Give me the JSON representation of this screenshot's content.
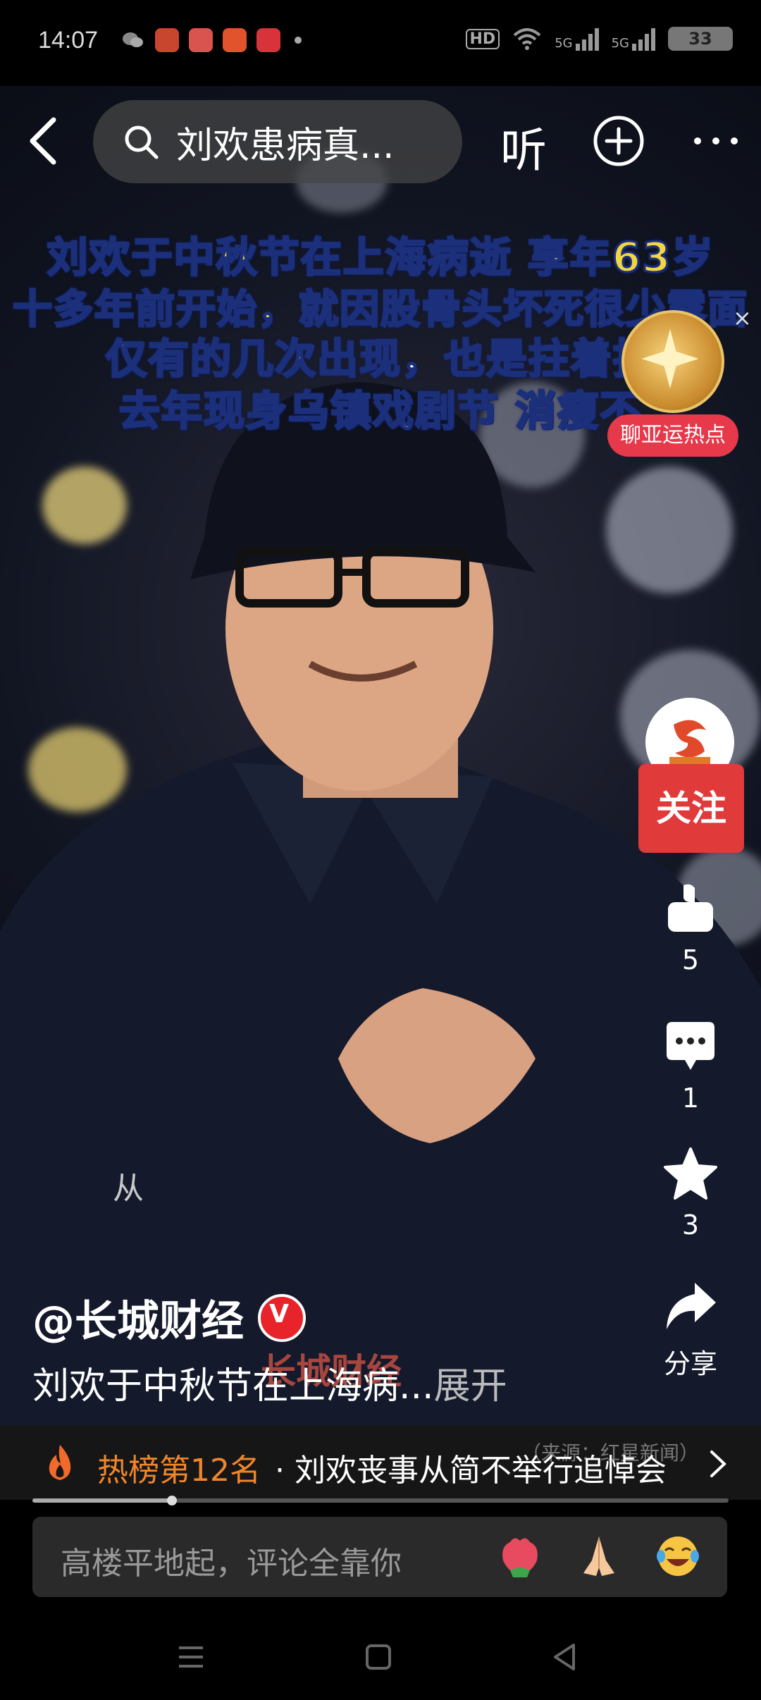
{
  "status_bar": {
    "time": "14:07",
    "network_label": "HD",
    "signal_1": "5G",
    "signal_2": "5G",
    "battery": "33"
  },
  "top_bar": {
    "search_text": "刘欢患病真...",
    "listen_label": "听"
  },
  "captions": {
    "line1": "刘欢于中秋节在上海病逝 享年63岁",
    "line2": "十多年前开始，就因股骨头坏死很少露面",
    "line3": "仅有的几次出现，也是拄着拐",
    "line4": "去年现身乌镇戏剧节 消瘦不"
  },
  "promo_badge": {
    "label": "聊亚运热点",
    "close": "×"
  },
  "right_rail": {
    "follow_label": "关注",
    "like_count": "5",
    "comment_count": "1",
    "favorite_count": "3",
    "share_label": "分享"
  },
  "video": {
    "overlay_char": "从",
    "author": "@长城财经",
    "verified_mark": "V",
    "description": "刘欢于中秋节在上海病...",
    "expand_label": "展开",
    "watermark_text": "长城财经"
  },
  "hot_rank": {
    "rank_label": "热榜第12名",
    "separator": "·",
    "topic": "刘欢丧事从简不举行追悼会",
    "source": "（来源：红星新闻）"
  },
  "playback": {
    "progress": 0.2
  },
  "comment_bar": {
    "placeholder": "高楼平地起，评论全靠你",
    "emojis": [
      "rose-emoji",
      "pray-emoji",
      "laugh-cry-emoji"
    ]
  },
  "colors": {
    "follow_red": "#e03a3a",
    "hot_orange": "#f0862a",
    "caption_yellow": "#f2d640",
    "caption_outline": "#1b2f7a"
  }
}
